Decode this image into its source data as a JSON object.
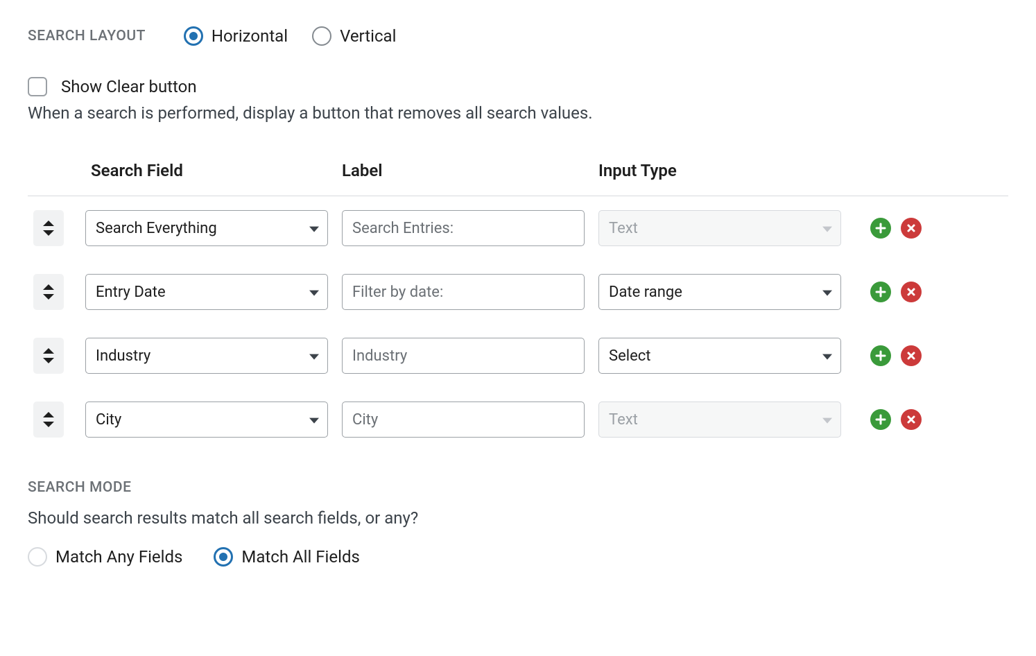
{
  "layout": {
    "heading": "SEARCH LAYOUT",
    "options": {
      "horizontal": "Horizontal",
      "vertical": "Vertical"
    },
    "selected": "horizontal"
  },
  "clear": {
    "label": "Show Clear button",
    "help": "When a search is performed, display a button that removes all search values."
  },
  "table": {
    "headers": {
      "field": "Search Field",
      "label": "Label",
      "type": "Input Type"
    },
    "rows": [
      {
        "field": "Search Everything",
        "label": "Search Entries:",
        "type": "Text",
        "type_disabled": true
      },
      {
        "field": "Entry Date",
        "label": "Filter by date:",
        "type": "Date range",
        "type_disabled": false
      },
      {
        "field": "Industry",
        "label": "Industry",
        "type": "Select",
        "type_disabled": false
      },
      {
        "field": "City",
        "label": "City",
        "type": "Text",
        "type_disabled": true
      }
    ]
  },
  "mode": {
    "heading": "SEARCH MODE",
    "help": "Should search results match all search fields, or any?",
    "options": {
      "any": "Match Any Fields",
      "all": "Match All Fields"
    },
    "selected": "all"
  }
}
